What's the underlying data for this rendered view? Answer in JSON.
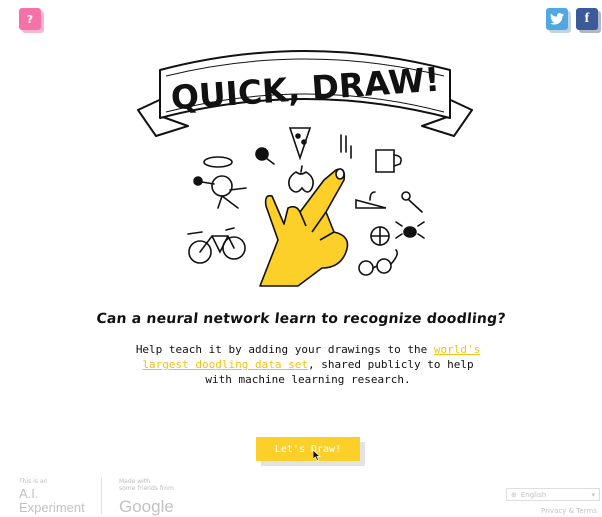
{
  "header": {
    "help_label": "?",
    "facebook_label": "f"
  },
  "hero": {
    "title": "QUICK, DRAW!"
  },
  "main": {
    "headline": "Can a neural network learn to recognize doodling?",
    "desc_before": "Help teach it by adding your drawings to the ",
    "desc_link": "world's largest doodling data set",
    "desc_after": ", shared publicly to help with machine learning research.",
    "cta_label": "Let's Draw!"
  },
  "footer": {
    "ai_small": "This is an",
    "ai_big_line1": "A.I.",
    "ai_big_line2": "Experiment",
    "made_with_line1": "Made with",
    "made_with_line2": "some friends from",
    "google_label": "Google",
    "language": "English",
    "privacy": "Privacy & Terms"
  },
  "colors": {
    "accent_yellow": "#fcd029",
    "help_pink": "#f472a7",
    "twitter_blue": "#4fa8e0",
    "facebook_blue": "#3b5a9a"
  },
  "icons": [
    "help-icon",
    "twitter-icon",
    "facebook-icon",
    "globe-icon",
    "chevron-down-icon"
  ]
}
